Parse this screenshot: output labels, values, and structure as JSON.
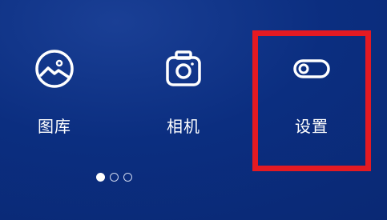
{
  "apps": [
    {
      "label": "图库",
      "icon": "gallery-icon"
    },
    {
      "label": "相机",
      "icon": "camera-icon"
    },
    {
      "label": "设置",
      "icon": "settings-toggle-icon"
    }
  ],
  "pager": {
    "total_pages": 3,
    "current_page": 1
  },
  "highlight": {
    "target": "设置",
    "color": "#e41a22"
  },
  "colors": {
    "background": "#0b2e80",
    "icon": "#ffffff"
  }
}
